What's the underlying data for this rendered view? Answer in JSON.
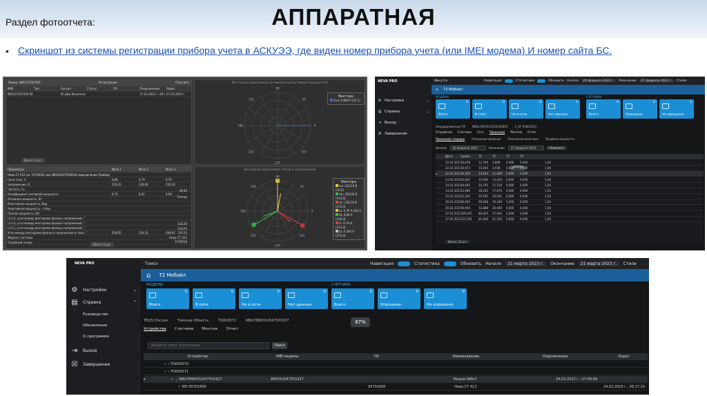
{
  "section_label": "Раздел фотоотчета:",
  "main_title": "АППАРАТНАЯ",
  "bullet_text": "Скриншот из системы регистрации прибора учета в АСКУЭЭ, где виден номер прибора учета (или IMEI модема) И номер сайта БС.",
  "shot1": {
    "top_table": {
      "cols": [
        "IMEI",
        "Тип",
        "Сигнал",
        "Статус",
        "ПУ",
        "Подключение",
        "Опрос"
      ],
      "rows": [
        [
          "866157037456 NB07",
          "",
          "05 дБм Включено",
          "",
          "",
          "27.03.2023 г. 06:00:28",
          "27.03.2023 г."
        ]
      ],
      "footer": "Всего: 1 шт."
    },
    "vec1": {
      "title": "Векторная диаграмма активной и реактивной мощностей",
      "legend_title": "Вектора",
      "legend": [
        "Sum 0,804 Р (22,1)"
      ]
    },
    "params": {
      "cols": [
        "Параметры",
        "Фаза 1",
        "Фаза 2",
        "Фаза 3"
      ],
      "group": "Нева СТ 412 (ю: 1570616) имс 86615037456018  подключение Прибор)",
      "rows": [
        [
          "Сила тока, А",
          "0,86",
          "0,79",
          "0,79"
        ],
        [
          "Напряжение, В",
          "229,20",
          "230,00",
          "230,10"
        ],
        [
          "Частота, Гц",
          "",
          "",
          ""
        ],
        [
          "Коэффициент активной мощности",
          "0,70",
          "0,41",
          "0,94"
        ],
        [
          "Активная мощность, Вт",
          "",
          "",
          ""
        ],
        [
          "Реактивная мощность, Вар",
          "",
          "",
          ""
        ],
        [
          "Реактивная мощность, + Вар",
          "",
          "",
          ""
        ],
        [
          "Полная мощность, ВА",
          "",
          "",
          ""
        ],
        [
          "L1-L2, угол между векторами фазных напряжений, °",
          "",
          "",
          ""
        ],
        [
          "L2-L3, угол между векторами фазных напряжений, °",
          "",
          "",
          ""
        ],
        [
          "L3-L1, угол между векторами фазных напряжений, °",
          "",
          "",
          ""
        ],
        [
          "Угол между векторами фазного напряжения и тока, °",
          "258,95",
          "124,33",
          "298,92"
        ],
        [
          "Модель счетчика",
          "",
          "",
          ""
        ],
        [
          "Серийный номер",
          "",
          "",
          ""
        ]
      ],
      "right_values": [
        "118,30",
        "118,50",
        "126,50",
        "Нева СТ 412",
        "1570616"
      ],
      "extra": [
        "49,95",
        "Тпатор"
      ],
      "footer": "Всего: 1 шт."
    },
    "vec2": {
      "title": "Векторная диаграмма токов и напряжений",
      "legend_title": "Вектора",
      "legend": [
        "Ua: 229,20 В (33,0)",
        "Ub: 230,00 В (153,0)",
        "Uc: 230,10 В (272,4)",
        "Ia: 0,79 А (94,7)",
        "Ib: 0,86 А (330,4)",
        "Ic: 0,79 А (213,4)",
        "Io: 0,304 А (273,4)"
      ]
    }
  },
  "shot2": {
    "sidebar": {
      "logo": "NEVA PRO",
      "items": [
        "Настройки",
        "Справка",
        "Выход",
        "Завершение"
      ]
    },
    "topbar": {
      "region": "Иркутск",
      "nav": "Навигация",
      "stats": "Статистика",
      "refresh": "Обновить",
      "start": "Начало",
      "start_date": "20 февраля 2023 г.",
      "end": "Окончание",
      "end_date": "27 февраля 2023 г.",
      "style": "Стили"
    },
    "operator": "Т2 Мобайл",
    "groups": [
      "МОДЕМЫ",
      "СЧЕТЧИКИ"
    ],
    "tiles": [
      {
        "label": "Всего",
        "count": "0"
      },
      {
        "label": "В сети",
        "count": "0"
      },
      {
        "label": "Не в сети",
        "count": "0"
      },
      {
        "label": "Нет данных",
        "count": "0"
      },
      {
        "label": "Всего",
        "count": "0"
      },
      {
        "label": "Опрошено",
        "count": "0"
      },
      {
        "label": "Не опрошено",
        "count": "0"
      }
    ],
    "breadcrumb": [
      "Неаудированные ПУ",
      "NB0x7863521056156604",
      "1_HF 93801263"
    ],
    "tabs": [
      "Устройства",
      "Счетчики",
      "Сеть",
      "Показания",
      "Монтаж",
      "Отчет"
    ],
    "subtabs": [
      "Показания текущие",
      "Показания дневные",
      "Показания месячные",
      "Профили мощности"
    ],
    "filter": {
      "start_label": "Начало:",
      "start": "20 февраля 2023",
      "end_label": "Окончание:",
      "end": "27 февраля 2023",
      "button": "Получить"
    },
    "progress": "100%",
    "columns": [
      "Дата",
      "Сумма",
      "T1",
      "T2",
      "T3",
      "T4"
    ],
    "rows": [
      [
        "22.02.2023 г. 0ч43",
        "10,678",
        "12,790",
        "3,899",
        "0,000",
        "0,000"
      ],
      [
        "22.02.2023 г. 0ч43",
        "19,873",
        "15,844",
        "4,038",
        "0,000",
        "0,000"
      ],
      [
        "22.02.2023 г. 0ч43",
        "26,200",
        "24,834",
        "11,408",
        "0,000",
        "0,000"
      ],
      [
        "23.02.2023 г. 0ч43",
        "40,845",
        "33,590",
        "13,419",
        "0,000",
        "0,000"
      ],
      [
        "24.02.2023 г. 0ч43",
        "49,645",
        "35,195",
        "17,218",
        "0,000",
        "0,000"
      ],
      [
        "24.02.2023 г. 0ч43",
        "52,080",
        "38,162",
        "17,870",
        "0,000",
        "0,000"
      ],
      [
        "25.02.2023 г. 0ч43",
        "55,205",
        "39,595",
        "19,041",
        "0,000",
        "0,000"
      ],
      [
        "26.02.2023 г. 0ч43",
        "86,940",
        "69,048",
        "30,348",
        "0,000",
        "0,000"
      ],
      [
        "26.02.2023 г. 0ч43",
        "90,905",
        "72,888",
        "36,000",
        "0,000",
        "0,000"
      ],
      [
        "27.02.2023 г. 0ч43",
        "109,505",
        "80,020",
        "37,000",
        "0,000",
        "0,000"
      ],
      [
        "27.02.2023 г. 0ч43",
        "121,505",
        "81,640",
        "41,250",
        "0,000",
        "0,000"
      ]
    ],
    "right_values": [
      "1,04",
      "1,04",
      "1,04",
      "1,04",
      "1,04",
      "1,04",
      "1,04",
      "1,04",
      "1,04",
      "1,04",
      "1,04"
    ],
    "footer": "Всего: 12 шт."
  },
  "shot3": {
    "sidebar": {
      "logo": "NEVA PRO",
      "items": [
        "Настройки",
        "Справка",
        "Выход",
        "Завершение"
      ],
      "subitems": [
        "Руководство",
        "Обновление",
        "О программе"
      ]
    },
    "topbar": {
      "region": "Томск",
      "nav": "Навигация",
      "stats": "Статистика",
      "refresh": "Обновить",
      "start": "Начало",
      "start_date": "21 марта 2023 г.",
      "end": "Окончание",
      "end_date": "21 марта 2023 г.",
      "style": "Стили"
    },
    "operator": "Т2 Мобайл",
    "groups": [
      "МОДЕМЫ",
      "СЧЕТЧИКИ"
    ],
    "tiles": [
      {
        "label": "Всего",
        "count": "0"
      },
      {
        "label": "В сети",
        "count": "0"
      },
      {
        "label": "Не в сети",
        "count": "0"
      },
      {
        "label": "Нет данных",
        "count": "0"
      },
      {
        "label": "Всего",
        "count": "0"
      },
      {
        "label": "Опрошено",
        "count": "0"
      },
      {
        "label": "Не опрошено",
        "count": "0"
      }
    ],
    "breadcrumb": [
      "TELE2 Россия",
      "Томская Область",
      "TO000571",
      "NBIoT866352047501927"
    ],
    "progress": "87%",
    "tabs": [
      "Устройства",
      "Счетчики",
      "Монтаж",
      "Отчет"
    ],
    "search_placeholder": "Введите текст для поиска...",
    "search_button": "Поиск",
    "columns": [
      "Устройство",
      "IMEI модема",
      "ПУ",
      "Наименование",
      "Подключение",
      "Опрос"
    ],
    "rows": [
      {
        "device": "TO000570",
        "imei": "",
        "pu": "",
        "name": "",
        "conn": "",
        "poll": ""
      },
      {
        "device": "TO000571",
        "imei": "",
        "pu": "",
        "name": "",
        "conn": "",
        "poll": ""
      },
      {
        "device": "NBIoT866352047501927",
        "imei": "866352047501927",
        "pu": "",
        "name": "Модем NBIoT",
        "conn": "24.03.2023 г., 07:09:08",
        "poll": ""
      },
      {
        "device": "МО 95701600",
        "imei": "",
        "pu": "95701600",
        "name": "Нева СТ 412",
        "conn": "",
        "poll": "24.03.2023 г., 06:17:20"
      }
    ]
  }
}
